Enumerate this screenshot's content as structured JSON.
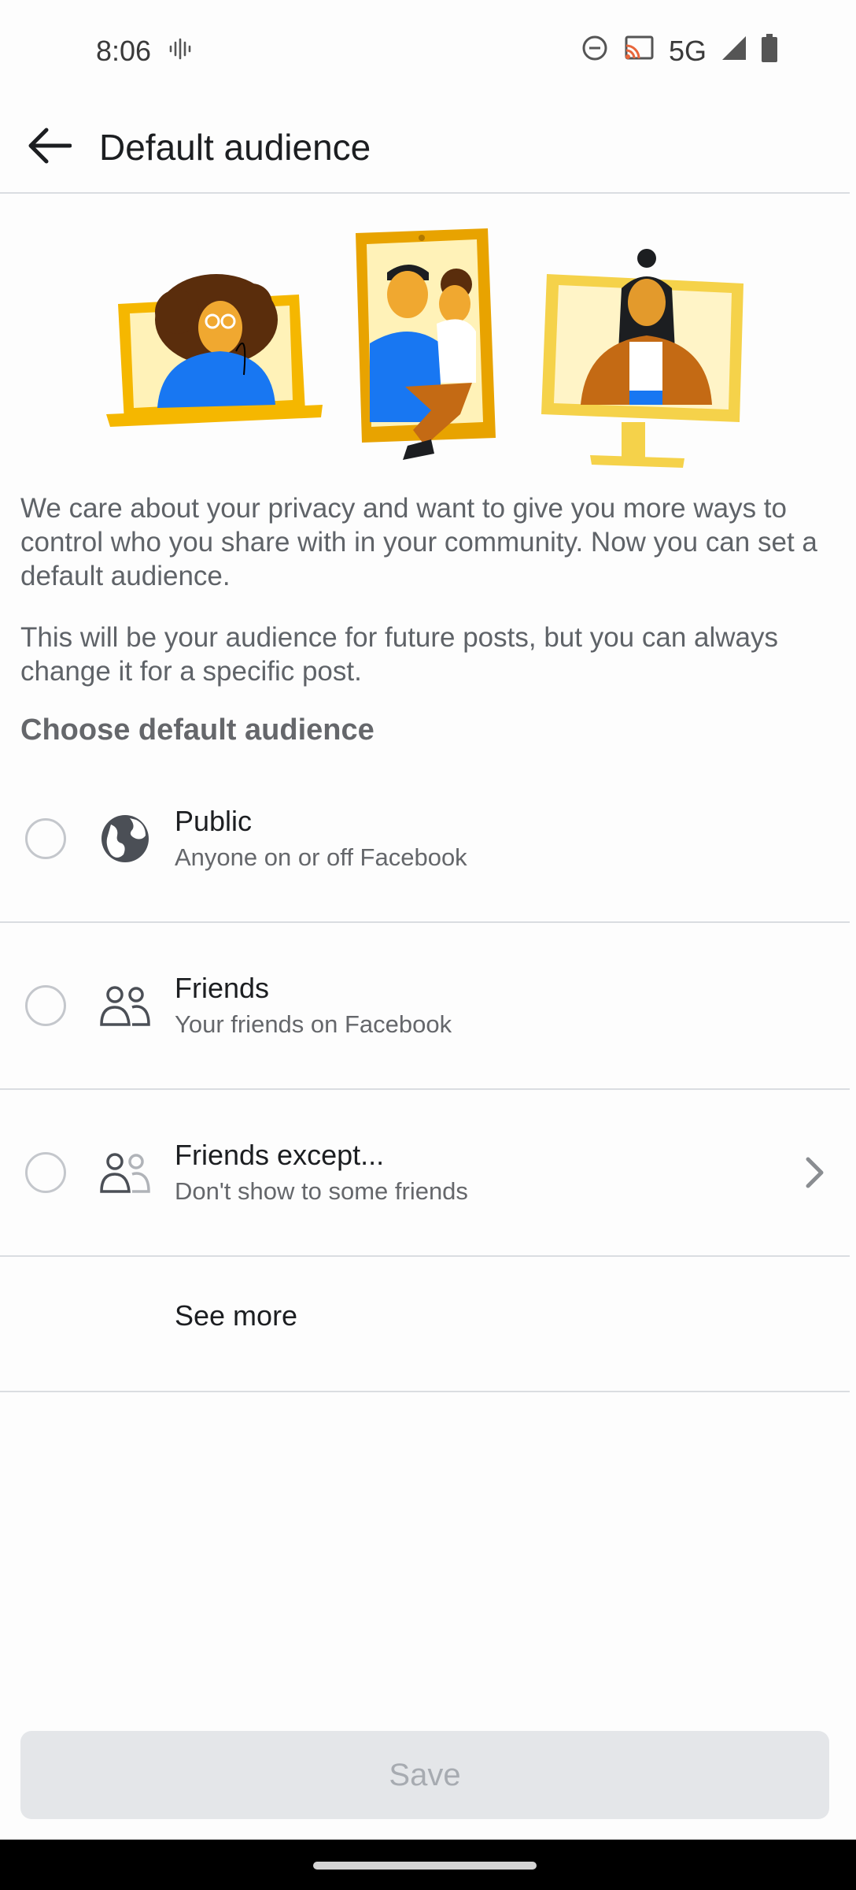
{
  "status_bar": {
    "time": "8:06",
    "network": "5G",
    "icons": [
      "vibrate-icon",
      "do-not-disturb-icon",
      "cast-icon",
      "signal-icon",
      "battery-icon"
    ]
  },
  "header": {
    "title": "Default audience",
    "back_icon": "arrow-left-icon"
  },
  "intro": {
    "paragraph_1": "We care about your privacy and want to give you more ways to control who you share with in your community. Now you can set a default audience.",
    "paragraph_2": "This will be your audience for future posts, but you can always change it for a specific post."
  },
  "section_heading": "Choose default audience",
  "options": [
    {
      "title": "Public",
      "subtitle": "Anyone on or off Facebook",
      "icon": "globe-icon",
      "selected": false
    },
    {
      "title": "Friends",
      "subtitle": "Your friends on Facebook",
      "icon": "friends-icon",
      "selected": false
    },
    {
      "title": "Friends except...",
      "subtitle": "Don't show to some friends",
      "icon": "friends-except-icon",
      "selected": false,
      "has_chevron": true
    }
  ],
  "see_more": "See more",
  "save_button": "Save",
  "colors": {
    "illustration_yellow": "#f5b700",
    "illustration_blue": "#1877f2",
    "disabled_button_bg": "#e4e6e9",
    "disabled_button_text": "#a7abb1"
  }
}
